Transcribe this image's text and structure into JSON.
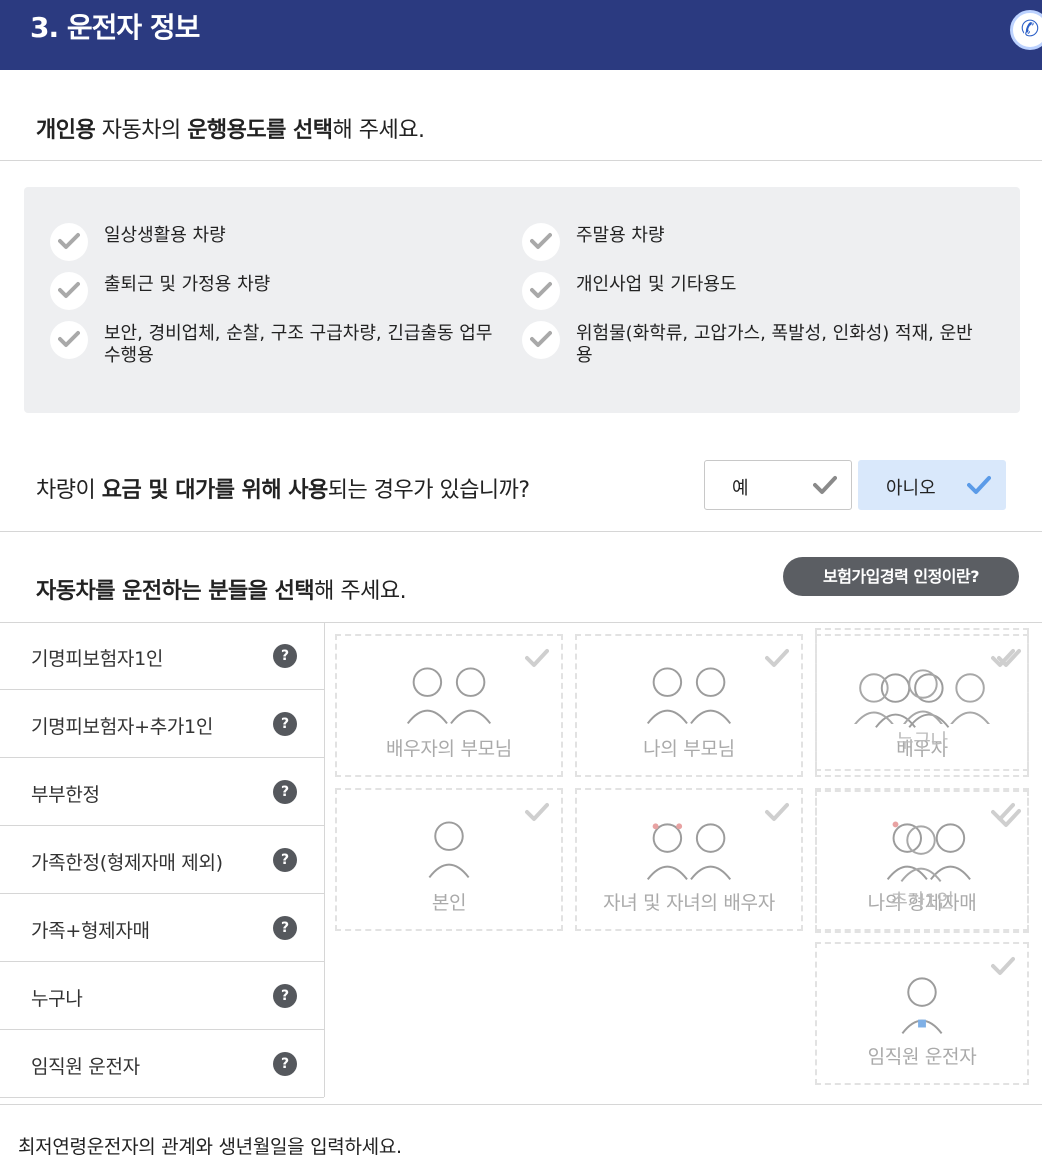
{
  "header": {
    "title": "3. 운전자 정보",
    "phone_icon": "phone-icon"
  },
  "usage": {
    "title_parts": [
      "개인용",
      " 자동차의 ",
      "운행용도를 선택",
      "해 주세요."
    ],
    "items": [
      {
        "label": "일상생활용 차량"
      },
      {
        "label": "주말용 차량"
      },
      {
        "label": "출퇴근 및 가정용 차량"
      },
      {
        "label": "개인사업 및 기타용도"
      },
      {
        "label": "보안, 경비업체, 순찰, 구조 구급차량, 긴급출동 업무수행용"
      },
      {
        "label": "위험물(화학류, 고압가스, 폭발성, 인화성) 적재, 운반용"
      }
    ]
  },
  "question": {
    "parts": [
      "차량이 ",
      "요금 및 대가를 위해 사용",
      "되는 경우가 있습니까?"
    ],
    "yes_label": "예",
    "no_label": "아니오",
    "selected": "아니오"
  },
  "drivers": {
    "title_parts": [
      "자동차를 운전하는 분들을 선택",
      "해 주세요."
    ],
    "history_button": "보험가입경력 인정이란?",
    "options": [
      {
        "label": "기명피보험자1인"
      },
      {
        "label": "기명피보험자+추가1인"
      },
      {
        "label": "부부한정"
      },
      {
        "label": "가족한정(형제자매 제외)"
      },
      {
        "label": "가족+형제자매"
      },
      {
        "label": "누구나"
      },
      {
        "label": "임직원 운전자"
      }
    ],
    "help_glyph": "?",
    "cards": [
      {
        "label": "배우자의 부모님"
      },
      {
        "label": "나의 부모님"
      },
      {
        "label": "배우자"
      },
      {
        "label": "누구나"
      },
      {
        "label": "본인"
      },
      {
        "label": "자녀 및 자녀의 배우자"
      },
      {
        "label": "나의 형제자매"
      },
      {
        "label": "추가1인"
      },
      {
        "label": "임직원 운전자"
      }
    ]
  },
  "footer_prompt": "최저연령운전자의 관계와 생년월일을 입력하세요.",
  "colors": {
    "header_bg": "#2b3a80",
    "selected_bg": "#d9e8fb",
    "check_blue": "#5b9be8",
    "pill_bg": "#5b5e63"
  }
}
